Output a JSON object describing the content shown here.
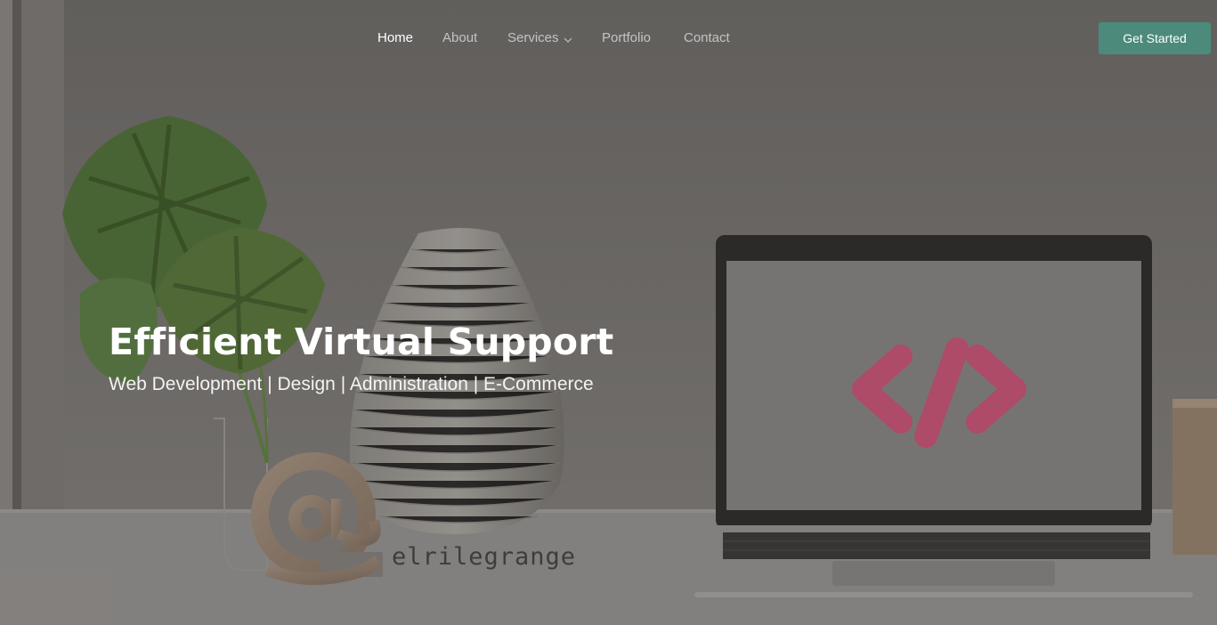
{
  "nav": {
    "items": [
      {
        "label": "Home",
        "active": true
      },
      {
        "label": "About",
        "active": false
      },
      {
        "label": "Services",
        "active": false,
        "has_dropdown": true
      },
      {
        "label": "Portfolio",
        "active": false
      },
      {
        "label": "Contact",
        "active": false
      }
    ],
    "cta_label": "Get Started"
  },
  "hero": {
    "title": "Efficient Virtual Support",
    "subtitle": "Web Development | Design | Administration | E-Commerce",
    "brand_text": "elrilegrange"
  },
  "colors": {
    "accent": "#4c8a7c",
    "wall": "#6f6c69",
    "desk": "#8a8785",
    "code_symbol": "#b8506f"
  },
  "icons": {
    "dropdown": "chevron-down-icon",
    "laptop_screen": "code-brackets-icon",
    "email_decor": "at-sign-icon"
  }
}
